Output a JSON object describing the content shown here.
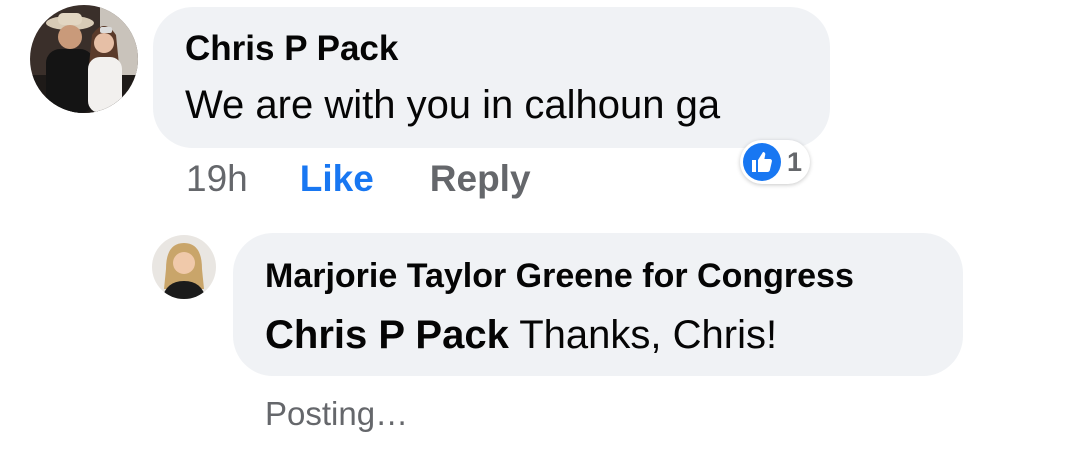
{
  "comment": {
    "author": "Chris P Pack",
    "text": "We are with you in calhoun ga",
    "timestamp": "19h",
    "like_label": "Like",
    "reply_label": "Reply",
    "reaction_count": "1",
    "reaction_icon": "thumbs-up-icon"
  },
  "reply": {
    "author": "Marjorie Taylor Greene for Congress",
    "mention": "Chris P Pack",
    "text": " Thanks, Chris!",
    "status": "Posting…"
  },
  "colors": {
    "bubble": "#f0f2f5",
    "link_blue": "#1877f2",
    "meta_gray": "#65676b",
    "text": "#050505"
  }
}
